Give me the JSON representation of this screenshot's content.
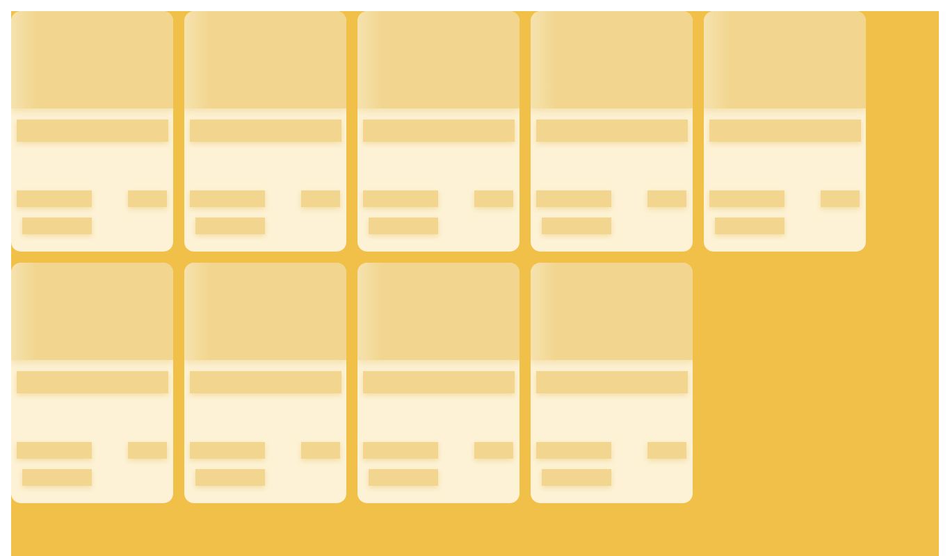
{
  "theme": {
    "background": "#F0C049",
    "card_background": "#FDF2D5",
    "placeholder": "#F2D68F",
    "placeholder_edge": "#F5E2AE"
  },
  "loading_cards": [
    {
      "index": 1,
      "state": "loading"
    },
    {
      "index": 2,
      "state": "loading"
    },
    {
      "index": 3,
      "state": "loading"
    },
    {
      "index": 4,
      "state": "loading"
    },
    {
      "index": 5,
      "state": "loading"
    },
    {
      "index": 6,
      "state": "loading"
    },
    {
      "index": 7,
      "state": "loading"
    },
    {
      "index": 8,
      "state": "loading"
    },
    {
      "index": 9,
      "state": "loading"
    }
  ]
}
